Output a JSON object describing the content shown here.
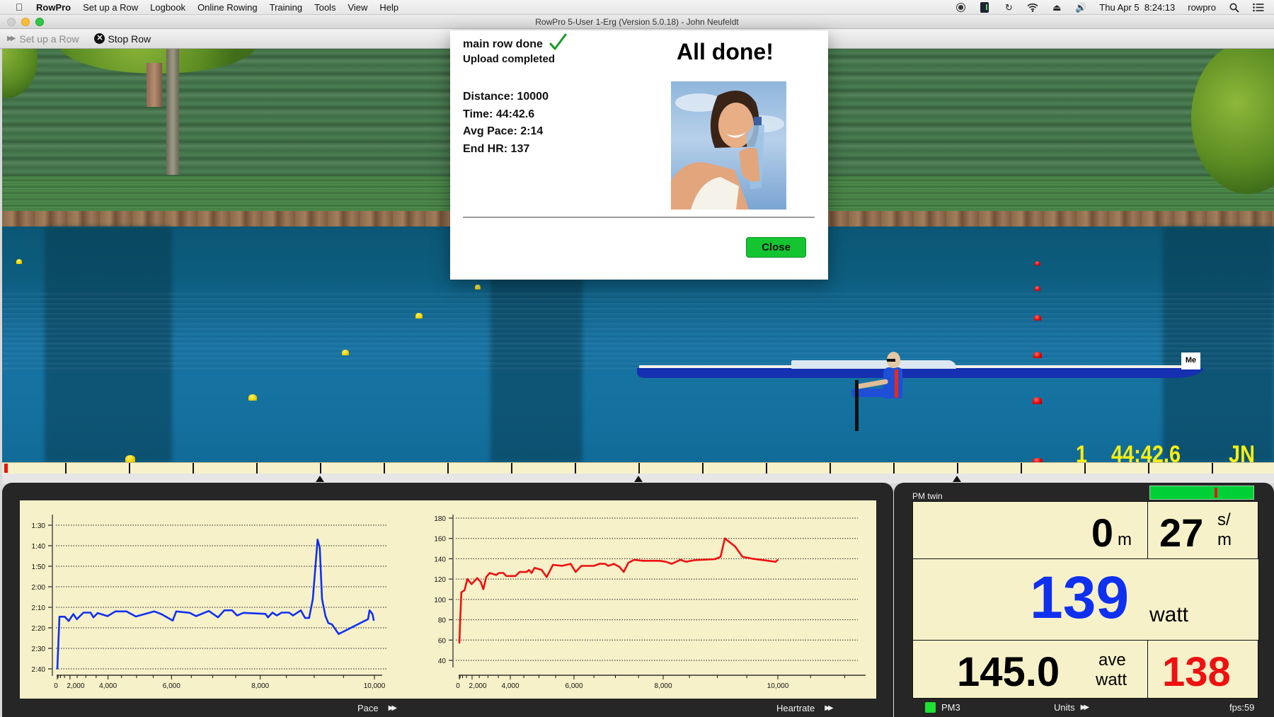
{
  "menubar": {
    "apple_icon": "apple-logo-icon",
    "items": [
      "RowPro",
      "Set up a Row",
      "Logbook",
      "Online Rowing",
      "Training",
      "Tools",
      "View",
      "Help"
    ],
    "status": {
      "icons": [
        "screen-record-icon",
        "sd-card-icon",
        "time-machine-icon",
        "wifi-icon",
        "eject-icon",
        "volume-icon"
      ],
      "datetime": "Thu Apr 5  8:24:13",
      "user": "rowpro",
      "search_icon": "search-icon",
      "notification_icon": "list-icon"
    }
  },
  "window": {
    "title": "RowPro 5-User 1-Erg (Version 5.0.18) - John Neufeldt"
  },
  "toolbar": {
    "setup_label": "Set up a Row",
    "stop_label": "Stop Row"
  },
  "scene": {
    "me_flag": "Me",
    "overlay": {
      "place": "1",
      "time": "44:42.6",
      "initials": "JN"
    },
    "colors": {
      "overlay_text": "#f6ee12",
      "yellow_buoy": "#f3d000",
      "red_buoy": "#e00000"
    }
  },
  "ruler": {
    "position_fraction": 0.0
  },
  "dialog": {
    "status_main": "main row done",
    "status_upload": "Upload completed",
    "heading": "All done!",
    "stats": [
      {
        "label": "Distance",
        "value": "10000",
        "text": "Distance: 10000"
      },
      {
        "label": "Time",
        "value": "44:42.6",
        "text": "Time: 44:42.6"
      },
      {
        "label": "Avg Pace",
        "value": "2:14",
        "text": "Avg Pace: 2:14"
      },
      {
        "label": "End HR",
        "value": "137",
        "text": "End HR: 137"
      }
    ],
    "close_label": "Close",
    "close_color": "#14c531"
  },
  "charts_panel": {
    "pace_label": "Pace",
    "heartrate_label": "Heartrate"
  },
  "pm": {
    "title": "PM twin",
    "bar_marker_fraction": 0.64,
    "distance_value": "0",
    "distance_unit": "m",
    "stroke_rate_value": "27",
    "stroke_rate_unit_top": "s/",
    "stroke_rate_unit_bottom": "m",
    "power_value": "139",
    "power_unit": "watt",
    "avg_power_value": "145.0",
    "avg_power_unit_top": "ave",
    "avg_power_unit_bottom": "watt",
    "heart_rate_value": "138",
    "colors": {
      "power": "#1030f0",
      "heart_rate": "#ee1111"
    },
    "monitor_label": "PM3",
    "units_label": "Units",
    "fps_label": "fps:59"
  },
  "chart_data": [
    {
      "type": "line",
      "title": "Pace",
      "xlabel": "",
      "ylabel": "",
      "x_scale": "quadratic",
      "xlim": [
        0,
        10000
      ],
      "x_ticks": [
        0,
        2000,
        4000,
        6000,
        8000,
        10000
      ],
      "x_tick_labels": [
        "0",
        "2,000",
        "4,000",
        "6,000",
        "8,000",
        "10,000"
      ],
      "y_inverted": true,
      "ylim_seconds": [
        90,
        160
      ],
      "y_ticks_seconds": [
        90,
        100,
        110,
        120,
        130,
        140,
        150,
        160
      ],
      "y_tick_labels": [
        "1:30",
        "1:40",
        "1:50",
        "2:00",
        "2:10",
        "2:20",
        "2:30",
        "2:40"
      ],
      "grid": true,
      "color": "#1030f0",
      "series": [
        {
          "name": "Pace (s/500m)",
          "x": [
            0,
            818,
            1531,
            1890,
            2246,
            2478,
            2874,
            3239,
            3374,
            3567,
            3981,
            4278,
            4668,
            4978,
            5530,
            5728,
            6032,
            6124,
            6461,
            6614,
            6911,
            7118,
            7258,
            7425,
            7530,
            7662,
            8101,
            8150,
            8238,
            8319,
            8412,
            8550,
            8621,
            8763,
            8839,
            8910,
            8977,
            9060,
            9098,
            9137,
            9197,
            9245,
            9306,
            9420,
            9899,
            9923,
            9969,
            9990
          ],
          "values": [
            160,
            134.6,
            134.6,
            136.7,
            133.3,
            135.8,
            132.6,
            132.6,
            134.9,
            132.8,
            134.3,
            132,
            132,
            134.5,
            132,
            133.3,
            136.5,
            132,
            132.7,
            134.3,
            131.8,
            134.9,
            131.5,
            131.5,
            134,
            132.7,
            133.2,
            134.9,
            132.6,
            134,
            132.6,
            132.6,
            134,
            131.5,
            135.2,
            135.2,
            126,
            97,
            101,
            126,
            134.3,
            137.7,
            138.3,
            143,
            135.8,
            131.5,
            133.2,
            136.4
          ]
        }
      ]
    },
    {
      "type": "line",
      "title": "Heartrate",
      "xlabel": "",
      "ylabel": "",
      "x_scale": "quadratic",
      "xlim": [
        0,
        10000
      ],
      "x_ticks": [
        0,
        2000,
        4000,
        6000,
        8000,
        10000
      ],
      "x_tick_labels": [
        "0",
        "2,000",
        "4,000",
        "6,000",
        "8,000",
        "10,000"
      ],
      "ylim": [
        40,
        180
      ],
      "y_ticks": [
        40,
        60,
        80,
        100,
        120,
        140,
        160,
        180
      ],
      "y_tick_labels": [
        "40",
        "60",
        "80",
        "100",
        "120",
        "140",
        "160",
        "180"
      ],
      "grid": true,
      "color": "#ee1111",
      "series": [
        {
          "name": "Heart rate (bpm)",
          "x": [
            0,
            537,
            803,
            1274,
            1585,
            1961,
            2371,
            2595,
            2745,
            2906,
            3088,
            3393,
            3525,
            3720,
            3838,
            4198,
            4353,
            4602,
            4674,
            4761,
            4860,
            5084,
            5236,
            5422,
            5675,
            5913,
            6043,
            6188,
            6494,
            6632,
            6770,
            6836,
            6964,
            7090,
            7183,
            7284,
            7408,
            7593,
            7935,
            8054,
            8165,
            8330,
            8436,
            8592,
            8959,
            9057,
            9130,
            9307,
            9428,
            9595,
            9776,
            9963,
            10000
          ],
          "values": [
            57,
            82,
            107,
            109,
            120,
            115,
            121,
            117,
            110,
            122,
            126,
            124,
            126,
            126,
            123,
            123,
            127,
            127,
            129,
            126,
            131,
            129,
            122,
            134,
            133,
            135,
            127,
            133,
            133,
            135,
            135,
            133,
            135,
            132,
            127,
            136,
            139,
            138,
            138,
            137,
            135,
            139,
            137,
            138.6,
            139.6,
            142,
            160,
            152,
            142,
            140,
            138.6,
            137,
            139
          ]
        }
      ]
    }
  ]
}
